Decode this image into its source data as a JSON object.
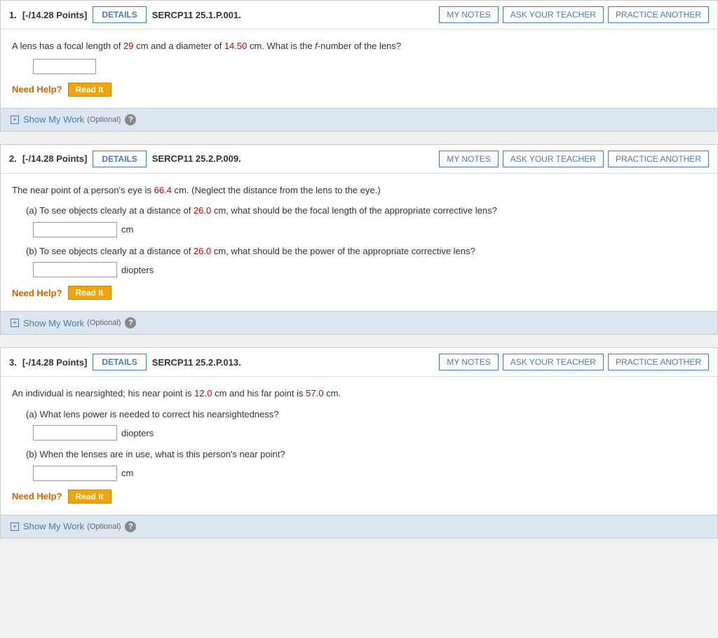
{
  "problems": [
    {
      "number": "1.",
      "points": "[-/14.28 Points]",
      "code": "SERCP11 25.1.P.001.",
      "question": "A lens has a focal length of {red:29} cm and a diameter of {red:14.50} cm. What is the {italic:f}-number of the lens?",
      "inputs": [
        {
          "id": "q1-ans",
          "unit": "",
          "placeholder": ""
        }
      ],
      "subQuestions": [],
      "needHelp": "Need Help?",
      "readItLabel": "Read It",
      "showMyWork": "Show My Work",
      "optional": "(Optional)",
      "buttons": {
        "details": "DETAILS",
        "myNotes": "MY NOTES",
        "askTeacher": "ASK YOUR TEACHER",
        "practiceAnother": "PRACTICE ANOTHER"
      }
    },
    {
      "number": "2.",
      "points": "[-/14.28 Points]",
      "code": "SERCP11 25.2.P.009.",
      "question": "The near point of a person's eye is {red:66.4} cm. (Neglect the distance from the lens to the eye.)",
      "subQuestions": [
        {
          "label": "(a) To see objects clearly at a distance of {red:26.0} cm, what should be the focal length of the appropriate corrective lens?",
          "inputId": "q2a-ans",
          "unit": "cm"
        },
        {
          "label": "(b) To see objects clearly at a distance of {red:26.0} cm, what should be the power of the appropriate corrective lens?",
          "inputId": "q2b-ans",
          "unit": "diopters"
        }
      ],
      "needHelp": "Need Help?",
      "readItLabel": "Read It",
      "showMyWork": "Show My Work",
      "optional": "(Optional)",
      "buttons": {
        "details": "DETAILS",
        "myNotes": "MY NOTES",
        "askTeacher": "ASK YOUR TEACHER",
        "practiceAnother": "PRACTICE ANOTHER"
      }
    },
    {
      "number": "3.",
      "points": "[-/14.28 Points]",
      "code": "SERCP11 25.2.P.013.",
      "question": "An individual is nearsighted; his near point is {red:12.0} cm and his far point is {red:57.0} cm.",
      "subQuestions": [
        {
          "label": "(a) What lens power is needed to correct his nearsightedness?",
          "inputId": "q3a-ans",
          "unit": "diopters"
        },
        {
          "label": "(b) When the lenses are in use, what is this person's near point?",
          "inputId": "q3b-ans",
          "unit": "cm"
        }
      ],
      "needHelp": "Need Help?",
      "readItLabel": "Read It",
      "showMyWork": "Show My Work",
      "optional": "(Optional)",
      "buttons": {
        "details": "DETAILS",
        "myNotes": "MY NOTES",
        "askTeacher": "ASK YOUR TEACHER",
        "practiceAnother": "PRACTICE ANOTHER"
      }
    }
  ]
}
